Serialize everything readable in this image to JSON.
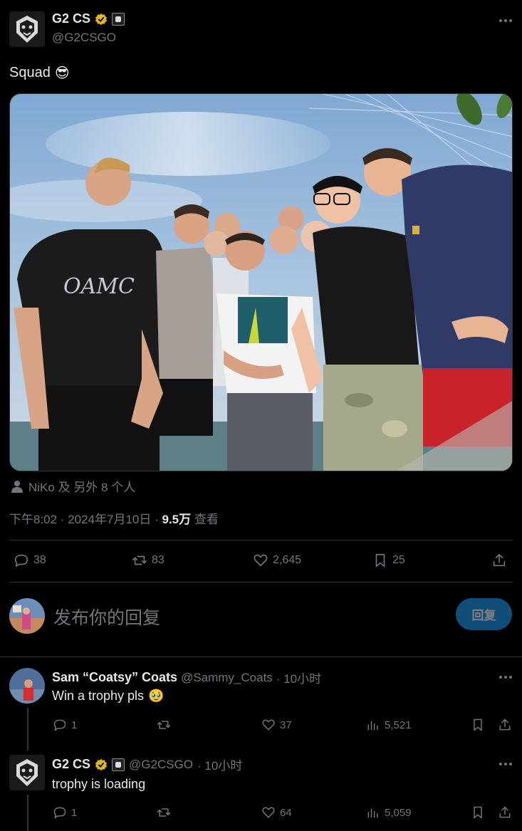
{
  "tweet": {
    "author_name": "G2 CS",
    "author_handle": "@G2CSGO",
    "text": "Squad",
    "emoji": "😎",
    "tagged": "NiKo 及 另外 8 个人",
    "time": "下午8:02 · 2024年7月10日 · ",
    "views_count": "9.5万",
    "views_label": " 查看",
    "stats": {
      "replies": "38",
      "retweets": "83",
      "likes": "2,645",
      "bookmarks": "25"
    }
  },
  "reply_box": {
    "placeholder": "发布你的回复",
    "button_label": "回复"
  },
  "replies": [
    {
      "author_name": "Sam “Coatsy” Coats",
      "author_handle": "@Sammy_Coats",
      "time": "· 10小时",
      "text": "Win a trophy pls",
      "emoji": "🥹",
      "replies": "1",
      "retweets": "",
      "likes": "37",
      "views": "5,521"
    },
    {
      "author_name": "G2 CS",
      "author_handle": "@G2CSGO",
      "time": "· 10小时",
      "text": "trophy is loading",
      "emoji": "",
      "replies": "1",
      "retweets": "",
      "likes": "64",
      "views": "5,059"
    }
  ],
  "colors": {
    "background": "#000000",
    "text": "#e7e9ea",
    "muted": "#71767b",
    "divider": "#2f3336",
    "reply_button": "#1d9bf0",
    "verified_gold": "#e2b719"
  }
}
